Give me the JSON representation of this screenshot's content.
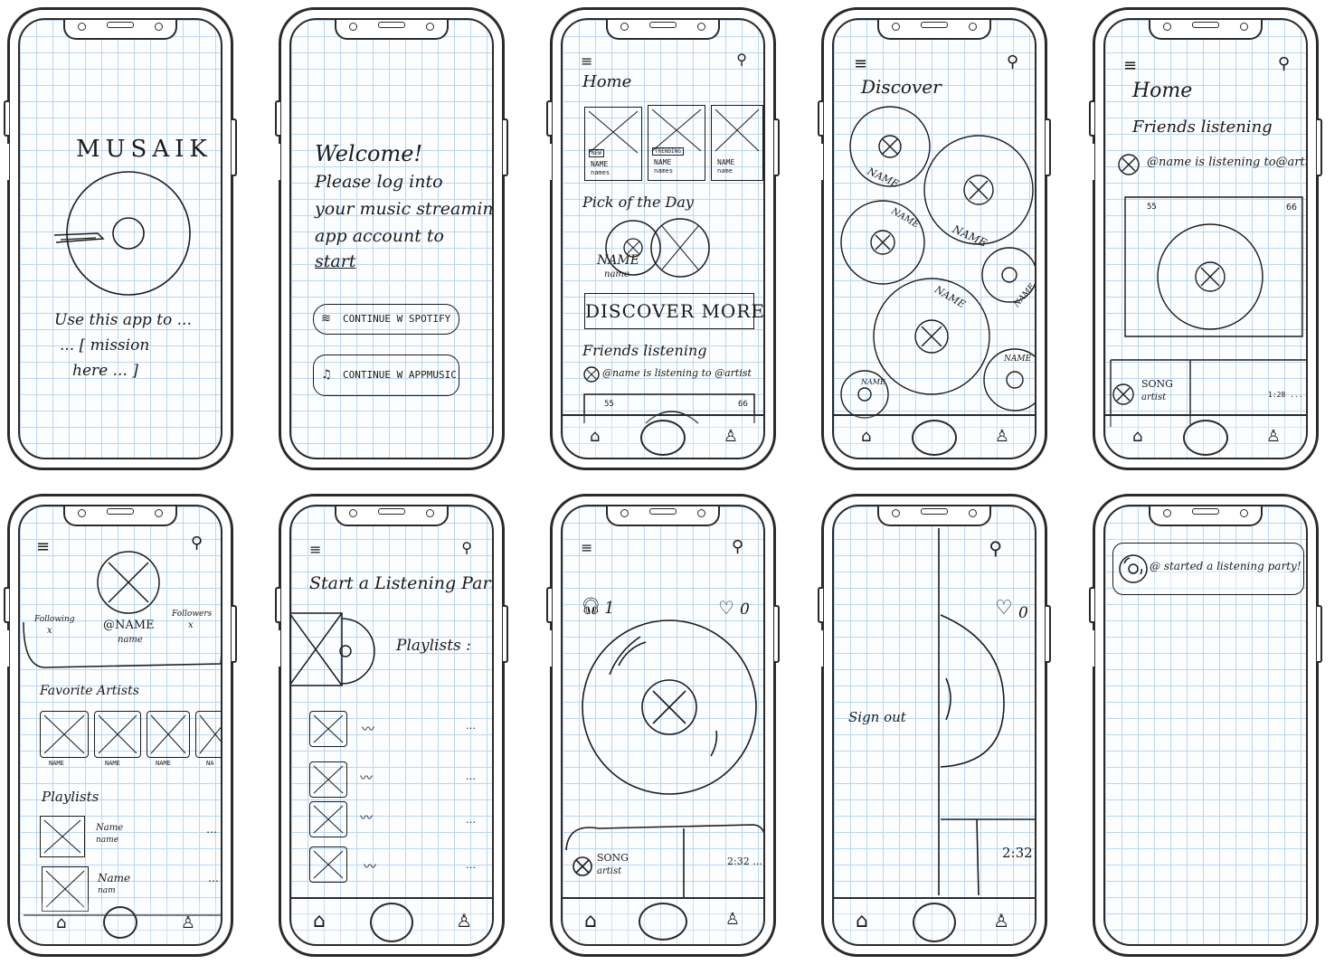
{
  "screens": {
    "splash": {
      "logo": "MUSAIK",
      "mission_line1": "Use  this app to ...",
      "mission_line2": "... [ mission",
      "mission_line3": "here ... ]"
    },
    "login": {
      "welcome": "Welcome!",
      "line1": "Please log into",
      "line2": "your  music streaming",
      "line3": "app account to",
      "line4": "start",
      "spotify_button": "CONTINUE W SPOTIFY",
      "apple_button": "CONTINUE W APPMUSIC"
    },
    "home": {
      "title": "Home",
      "tiles": [
        {
          "badge": "NEW",
          "name": "NAME",
          "sub": "names"
        },
        {
          "badge": "TRENDING",
          "name": "NAME",
          "sub": "names"
        },
        {
          "badge": "",
          "name": "NAME",
          "sub": "name"
        }
      ],
      "pick_title": "Pick of the Day",
      "pick_name": "NAME",
      "pick_sub": "name",
      "discover_button": "DISCOVER  MORE",
      "friends_title": "Friends  listening",
      "friend_status": "@name  is listening  to @artist",
      "listeners": "55",
      "likes": "66"
    },
    "discover": {
      "title": "Discover",
      "labels": [
        "NAME",
        "NAME",
        "NAME",
        "NAME",
        "NAME",
        "NAME",
        "NAME"
      ]
    },
    "friends": {
      "title": "Home",
      "subtitle": "Friends listening",
      "status": "@name  is listening to@artist",
      "listeners": "55",
      "likes": "66",
      "song": "SONG",
      "artist": "artist",
      "time": "1:28 ..."
    },
    "profile": {
      "following_label": "Following",
      "following_val": "x",
      "handle": "@NAME",
      "name": "name",
      "followers_label": "Followers",
      "followers_val": "x",
      "fav_title": "Favorite Artists",
      "fav_names": [
        "NAME",
        "NAME",
        "NAME",
        "NA"
      ],
      "playlists_title": "Playlists",
      "playlists": [
        {
          "name": "Name",
          "sub": "name"
        },
        {
          "name": "Name",
          "sub": "nam"
        }
      ]
    },
    "party": {
      "title": "Start  a  Listening  Party",
      "playlists_label": "Playlists :"
    },
    "player": {
      "listeners": "1",
      "likes": "0",
      "song": "SONG",
      "artist": "artist",
      "time": "2:32 ..."
    },
    "menu": {
      "signout": "Sign out",
      "likes": "0",
      "time": "2:32"
    },
    "notification": {
      "text": "@ started  a  listening  party!"
    }
  }
}
